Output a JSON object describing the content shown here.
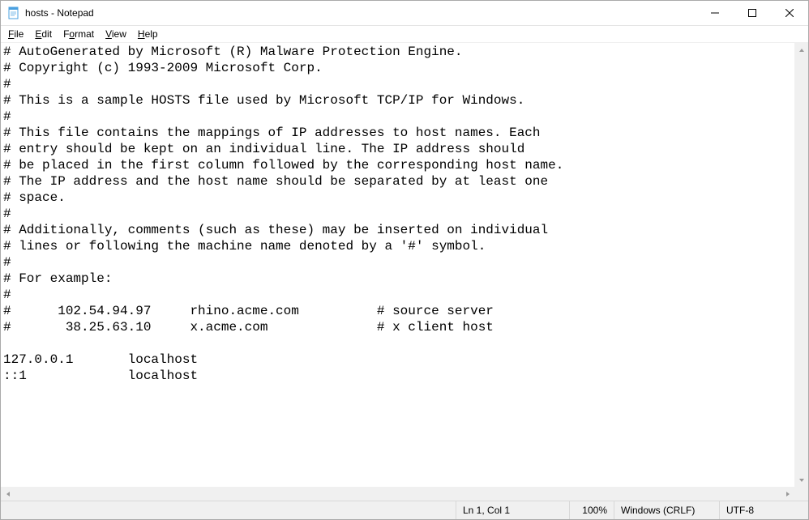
{
  "window": {
    "title": "hosts - Notepad"
  },
  "menu": {
    "file": "File",
    "edit": "Edit",
    "format": "Format",
    "view": "View",
    "help": "Help"
  },
  "content": "# AutoGenerated by Microsoft (R) Malware Protection Engine.\n# Copyright (c) 1993-2009 Microsoft Corp.\n#\n# This is a sample HOSTS file used by Microsoft TCP/IP for Windows.\n#\n# This file contains the mappings of IP addresses to host names. Each\n# entry should be kept on an individual line. The IP address should\n# be placed in the first column followed by the corresponding host name.\n# The IP address and the host name should be separated by at least one\n# space.\n#\n# Additionally, comments (such as these) may be inserted on individual\n# lines or following the machine name denoted by a '#' symbol.\n#\n# For example:\n#\n#      102.54.94.97     rhino.acme.com          # source server\n#       38.25.63.10     x.acme.com              # x client host\n\n127.0.0.1       localhost\n::1             localhost",
  "status": {
    "position": "Ln 1, Col 1",
    "zoom": "100%",
    "eol": "Windows (CRLF)",
    "encoding": "UTF-8"
  }
}
